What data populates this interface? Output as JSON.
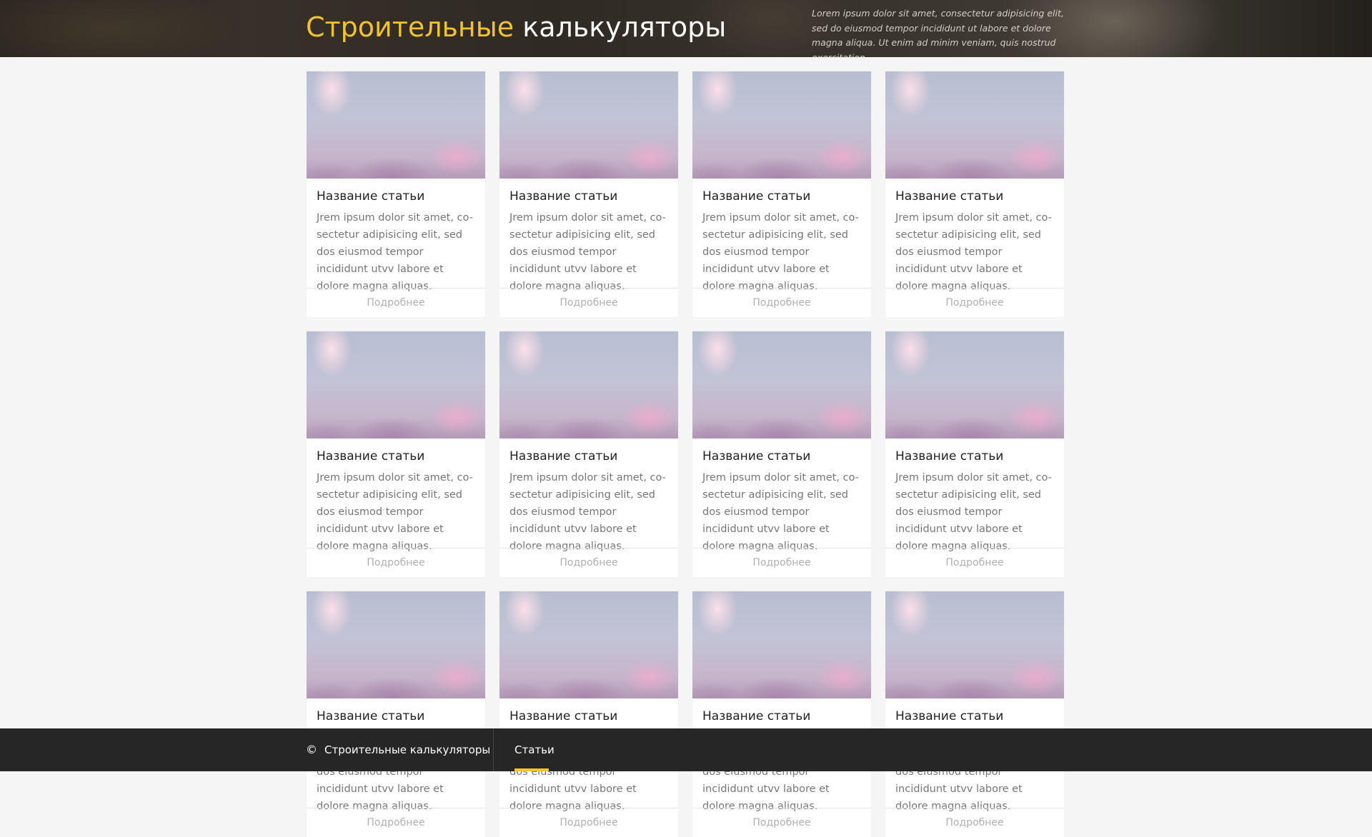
{
  "header": {
    "title_accent": "Строительные",
    "title_rest": "калькуляторы",
    "description": "Lorem ipsum dolor sit amet, consectetur adipisicing elit, sed do eiusmod tempor incididunt ut labore et dolore magna aliqua. Ut enim ad minim veniam, quis nostrud exercitation"
  },
  "articles": [
    {
      "title": "Название статьи",
      "text": "Jrem ipsum dolor sit amet, co-sectetur adipisicing elit, sed dos eiusmod tempor incididunt utvv labore et dolore magna aliquas.",
      "more": "Подробнее"
    },
    {
      "title": "Название статьи",
      "text": "Jrem ipsum dolor sit amet, co-sectetur adipisicing elit, sed dos eiusmod tempor incididunt utvv labore et dolore magna aliquas.",
      "more": "Подробнее"
    },
    {
      "title": "Название статьи",
      "text": "Jrem ipsum dolor sit amet, co-sectetur adipisicing elit, sed dos eiusmod tempor incididunt utvv labore et dolore magna aliquas.",
      "more": "Подробнее"
    },
    {
      "title": "Название статьи",
      "text": "Jrem ipsum dolor sit amet, co-sectetur adipisicing elit, sed dos eiusmod tempor incididunt utvv labore et dolore magna aliquas.",
      "more": "Подробнее"
    },
    {
      "title": "Название статьи",
      "text": "Jrem ipsum dolor sit amet, co-sectetur adipisicing elit, sed dos eiusmod tempor incididunt utvv labore et dolore magna aliquas.",
      "more": "Подробнее"
    },
    {
      "title": "Название статьи",
      "text": "Jrem ipsum dolor sit amet, co-sectetur adipisicing elit, sed dos eiusmod tempor incididunt utvv labore et dolore magna aliquas.",
      "more": "Подробнее"
    },
    {
      "title": "Название статьи",
      "text": "Jrem ipsum dolor sit amet, co-sectetur adipisicing elit, sed dos eiusmod tempor incididunt utvv labore et dolore magna aliquas.",
      "more": "Подробнее"
    },
    {
      "title": "Название статьи",
      "text": "Jrem ipsum dolor sit amet, co-sectetur adipisicing elit, sed dos eiusmod tempor incididunt utvv labore et dolore magna aliquas.",
      "more": "Подробнее"
    },
    {
      "title": "Название статьи",
      "text": "Jrem ipsum dolor sit amet, co-sectetur adipisicing elit, sed dos eiusmod tempor incididunt utvv labore et dolore magna aliquas.",
      "more": "Подробнее"
    },
    {
      "title": "Название статьи",
      "text": "Jrem ipsum dolor sit amet, co-sectetur adipisicing elit, sed dos eiusmod tempor incididunt utvv labore et dolore magna aliquas.",
      "more": "Подробнее"
    },
    {
      "title": "Название статьи",
      "text": "Jrem ipsum dolor sit amet, co-sectetur adipisicing elit, sed dos eiusmod tempor incididunt utvv labore et dolore magna aliquas.",
      "more": "Подробнее"
    },
    {
      "title": "Название статьи",
      "text": "Jrem ipsum dolor sit amet, co-sectetur adipisicing elit, sed dos eiusmod tempor incididunt utvv labore et dolore magna aliquas.",
      "more": "Подробнее"
    }
  ],
  "footer": {
    "copyright_icon": "©",
    "copyright_text": "Строительные калькуляторы",
    "nav_active": "Статьи"
  },
  "colors": {
    "accent": "#f2c230",
    "footer_bg": "#262626",
    "page_bg": "#f5f5f5"
  }
}
